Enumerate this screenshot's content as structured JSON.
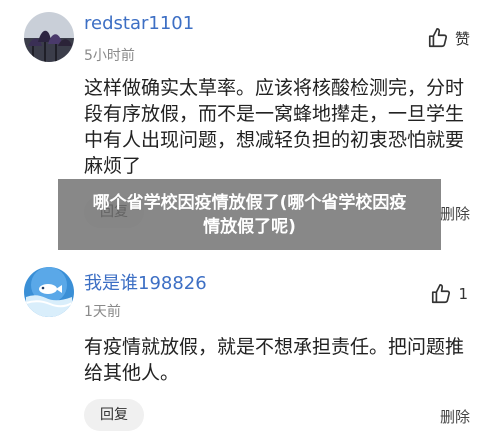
{
  "comments": [
    {
      "username": "redstar1101",
      "time": "5小时前",
      "like_label": "赞",
      "text": "这样做确实太草率。应该将核酸检测完，分时段有序放假，而不是一窝蜂地撵走，一旦学生中有人出现问题，想减轻负担的初衷恐怕就要麻烦了",
      "reply_label": "回复",
      "delete_label": "删除",
      "avatar_icon": "flower-photo-avatar"
    },
    {
      "username": "我是谁198826",
      "time": "1天前",
      "like_count": "1",
      "text": "有疫情就放假，就是不想承担责任。把问题推给其他人。",
      "reply_label": "回复",
      "delete_label": "删除",
      "avatar_icon": "fish-cartoon-avatar"
    }
  ],
  "overlay": {
    "title": "哪个省学校因疫情放假了(哪个省学校因疫情放假了呢)"
  },
  "colors": {
    "username": "#3d6fc4",
    "overlay_bg": "#6e6e6e"
  }
}
